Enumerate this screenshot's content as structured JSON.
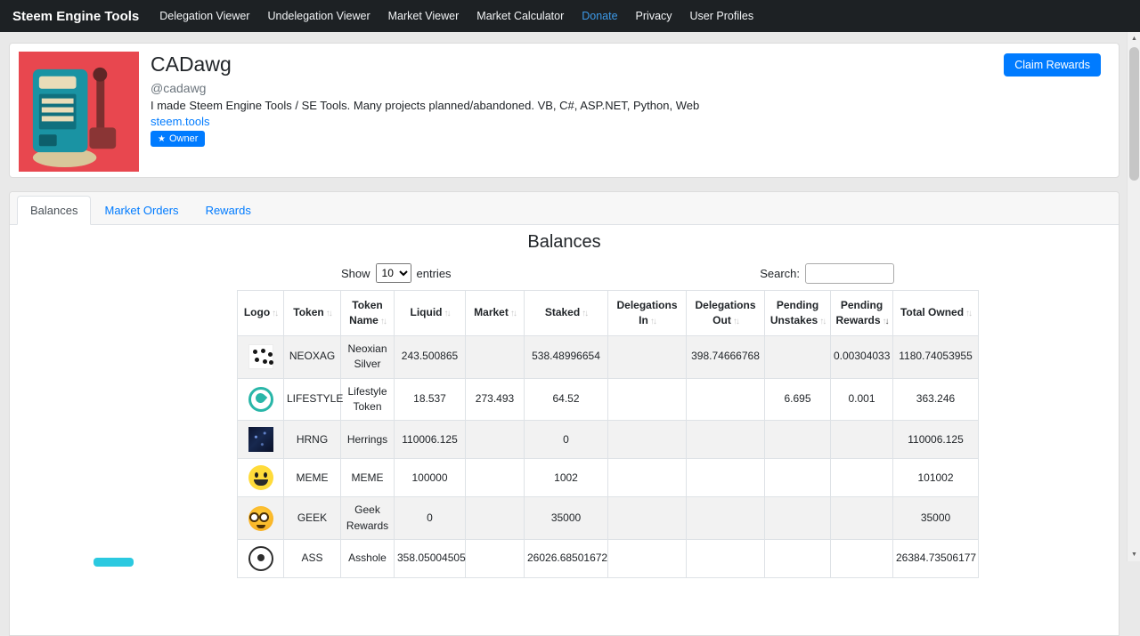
{
  "colors": {
    "navbar_bg": "#1d2124",
    "accent": "#007bff",
    "donate_link": "#3d9ae8",
    "stripe": "#f2f2f2",
    "border": "#dee2e6"
  },
  "navbar": {
    "brand": "Steem Engine Tools",
    "items": [
      {
        "label": "Delegation Viewer",
        "highlight": false
      },
      {
        "label": "Undelegation Viewer",
        "highlight": false
      },
      {
        "label": "Market Viewer",
        "highlight": false
      },
      {
        "label": "Market Calculator",
        "highlight": false
      },
      {
        "label": "Donate",
        "highlight": true
      },
      {
        "label": "Privacy",
        "highlight": false
      },
      {
        "label": "User Profiles",
        "highlight": false
      }
    ]
  },
  "profile": {
    "name": "CADawg",
    "handle": "@cadawg",
    "bio": "I made Steem Engine Tools / SE Tools. Many projects planned/abandoned. VB, C#, ASP.NET, Python, Web",
    "website": "steem.tools",
    "badge": "Owner",
    "claim_button": "Claim Rewards"
  },
  "tabs": [
    {
      "label": "Balances",
      "active": true
    },
    {
      "label": "Market Orders",
      "active": false
    },
    {
      "label": "Rewards",
      "active": false
    }
  ],
  "balances": {
    "heading": "Balances",
    "show_label": "Show",
    "entries_label": "entries",
    "page_size": "10",
    "search_label": "Search:",
    "search_value": "",
    "table": {
      "columns": [
        {
          "label": "Logo"
        },
        {
          "label": "Token"
        },
        {
          "label": "Token Name"
        },
        {
          "label": "Liquid"
        },
        {
          "label": "Market"
        },
        {
          "label": "Staked"
        },
        {
          "label": "Delegations In"
        },
        {
          "label": "Delegations Out"
        },
        {
          "label": "Pending Unstakes"
        },
        {
          "label": "Pending Rewards",
          "sorted": "desc"
        },
        {
          "label": "Total Owned"
        }
      ],
      "rows": [
        {
          "logo": "neoxag",
          "token": "NEOXAG",
          "token_name": "Neoxian Silver",
          "liquid": "243.500865",
          "market": "",
          "staked": "538.48996654",
          "delegations_in": "",
          "delegations_out": "398.74666768",
          "pending_unstakes": "",
          "pending_rewards": "0.00304033",
          "total_owned": "1180.74053955"
        },
        {
          "logo": "lifestyle",
          "token": "LIFESTYLE",
          "token_name": "Lifestyle Token",
          "liquid": "18.537",
          "market": "273.493",
          "staked": "64.52",
          "delegations_in": "",
          "delegations_out": "",
          "pending_unstakes": "6.695",
          "pending_rewards": "0.001",
          "total_owned": "363.246"
        },
        {
          "logo": "hrng",
          "token": "HRNG",
          "token_name": "Herrings",
          "liquid": "110006.125",
          "market": "",
          "staked": "0",
          "delegations_in": "",
          "delegations_out": "",
          "pending_unstakes": "",
          "pending_rewards": "",
          "total_owned": "110006.125"
        },
        {
          "logo": "meme",
          "token": "MEME",
          "token_name": "MEME",
          "liquid": "100000",
          "market": "",
          "staked": "1002",
          "delegations_in": "",
          "delegations_out": "",
          "pending_unstakes": "",
          "pending_rewards": "",
          "total_owned": "101002"
        },
        {
          "logo": "geek",
          "token": "GEEK",
          "token_name": "Geek Rewards",
          "liquid": "0",
          "market": "",
          "staked": "35000",
          "delegations_in": "",
          "delegations_out": "",
          "pending_unstakes": "",
          "pending_rewards": "",
          "total_owned": "35000"
        },
        {
          "logo": "ass",
          "token": "ASS",
          "token_name": "Asshole",
          "liquid": "358.05004505",
          "market": "",
          "staked": "26026.68501672",
          "delegations_in": "",
          "delegations_out": "",
          "pending_unstakes": "",
          "pending_rewards": "",
          "total_owned": "26384.73506177"
        }
      ]
    }
  }
}
